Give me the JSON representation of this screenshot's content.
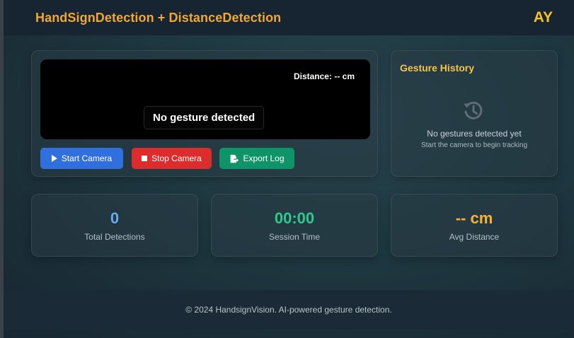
{
  "header": {
    "title": "HandSignDetection + DistanceDetection",
    "avatar_initials": "AY"
  },
  "camera": {
    "distance_label": "Distance:",
    "distance_value": "-- cm",
    "gesture_status": "No gesture detected",
    "buttons": {
      "start": "Start Camera",
      "stop": "Stop Camera",
      "export": "Export Log"
    }
  },
  "history": {
    "title": "Gesture History",
    "empty_message": "No gestures detected yet",
    "hint": "Start the camera to begin tracking",
    "icon": "history-icon"
  },
  "stats": [
    {
      "value": "0",
      "label": "Total Detections",
      "color": "#6aa8f0"
    },
    {
      "value": "00:00",
      "label": "Session Time",
      "color": "#2ec98e"
    },
    {
      "value": "-- cm",
      "label": "Avg Distance",
      "color": "#f5b431"
    }
  ],
  "footer": {
    "text": "© 2024 HandsignVision. AI-powered gesture detection."
  },
  "colors": {
    "brand": "#f0a830",
    "start_button": "#2f6fde",
    "stop_button": "#dc2c2c",
    "export_button": "#0f9467"
  }
}
